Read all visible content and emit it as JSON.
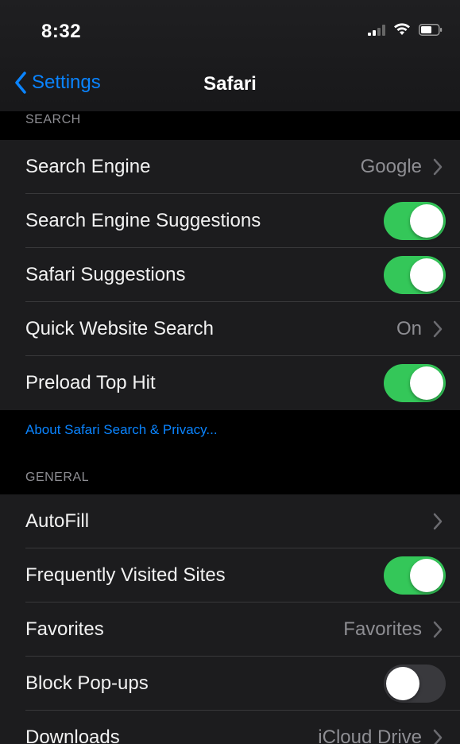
{
  "status_bar": {
    "time": "8:32",
    "icons": [
      "signal-icon",
      "wifi-icon",
      "battery-icon"
    ]
  },
  "nav": {
    "back_label": "Settings",
    "title": "Safari"
  },
  "sections": {
    "search": {
      "header": "SEARCH",
      "rows": [
        {
          "label": "Search Engine",
          "value": "Google",
          "control": "chevron"
        },
        {
          "label": "Search Engine Suggestions",
          "control": "toggle",
          "on": true
        },
        {
          "label": "Safari Suggestions",
          "control": "toggle",
          "on": true
        },
        {
          "label": "Quick Website Search",
          "value": "On",
          "control": "chevron"
        },
        {
          "label": "Preload Top Hit",
          "control": "toggle",
          "on": true
        }
      ],
      "footer_link": "About Safari Search & Privacy..."
    },
    "general": {
      "header": "GENERAL",
      "rows": [
        {
          "label": "AutoFill",
          "value": "",
          "control": "chevron"
        },
        {
          "label": "Frequently Visited Sites",
          "control": "toggle",
          "on": true
        },
        {
          "label": "Favorites",
          "value": "Favorites",
          "control": "chevron"
        },
        {
          "label": "Block Pop-ups",
          "control": "toggle",
          "on": false
        },
        {
          "label": "Downloads",
          "value": "iCloud Drive",
          "control": "chevron"
        }
      ]
    }
  },
  "colors": {
    "accent": "#0a84ff",
    "toggle_on": "#34c759",
    "toggle_off": "#39393d",
    "cell_bg": "#1c1c1e"
  }
}
